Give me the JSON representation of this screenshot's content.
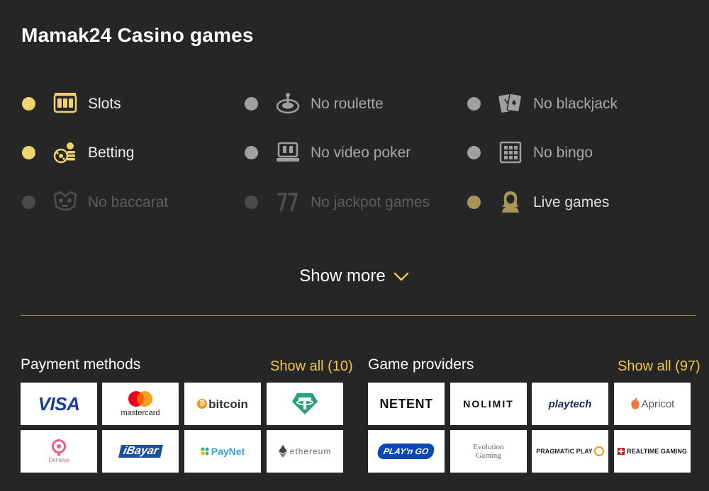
{
  "casino_games": {
    "title": "Mamak24 Casino games",
    "items": [
      {
        "label": "Slots",
        "state": "on",
        "icon": "slot-machine-icon"
      },
      {
        "label": "No roulette",
        "state": "off",
        "icon": "roulette-icon"
      },
      {
        "label": "No blackjack",
        "state": "off",
        "icon": "playing-cards-icon"
      },
      {
        "label": "Betting",
        "state": "on",
        "icon": "betting-icon"
      },
      {
        "label": "No video poker",
        "state": "off",
        "icon": "video-poker-icon"
      },
      {
        "label": "No bingo",
        "state": "off",
        "icon": "bingo-icon"
      },
      {
        "label": "No baccarat",
        "state": "dim",
        "icon": "baccarat-icon"
      },
      {
        "label": "No jackpot games",
        "state": "dim",
        "icon": "jackpot-icon"
      },
      {
        "label": "Live games",
        "state": "live",
        "icon": "live-dealer-icon"
      }
    ],
    "show_more_label": "Show more",
    "show_more_icon": "chevron-down-icon"
  },
  "payment_methods": {
    "heading": "Payment methods",
    "show_all_label": "Show all (10)",
    "logos": [
      "VISA",
      "mastercard",
      "bitcoin",
      "tether",
      "DeHave",
      "iBayar",
      "PayNet",
      "ethereum"
    ]
  },
  "game_providers": {
    "heading": "Game providers",
    "show_all_label": "Show all (97)",
    "logos": [
      "NETENT",
      "NOLIMIT",
      "playtech",
      "Apricot",
      "PLAY'n GO",
      "Evolution Gaming",
      "PRAGMATIC PLAY",
      "REALTIME GAMING"
    ]
  },
  "colors": {
    "background": "#262626",
    "accent_gold": "#f0c84a",
    "dot_on": "#f3d36e",
    "dot_off": "#a0a0a0",
    "divider": "#9a8a52"
  }
}
